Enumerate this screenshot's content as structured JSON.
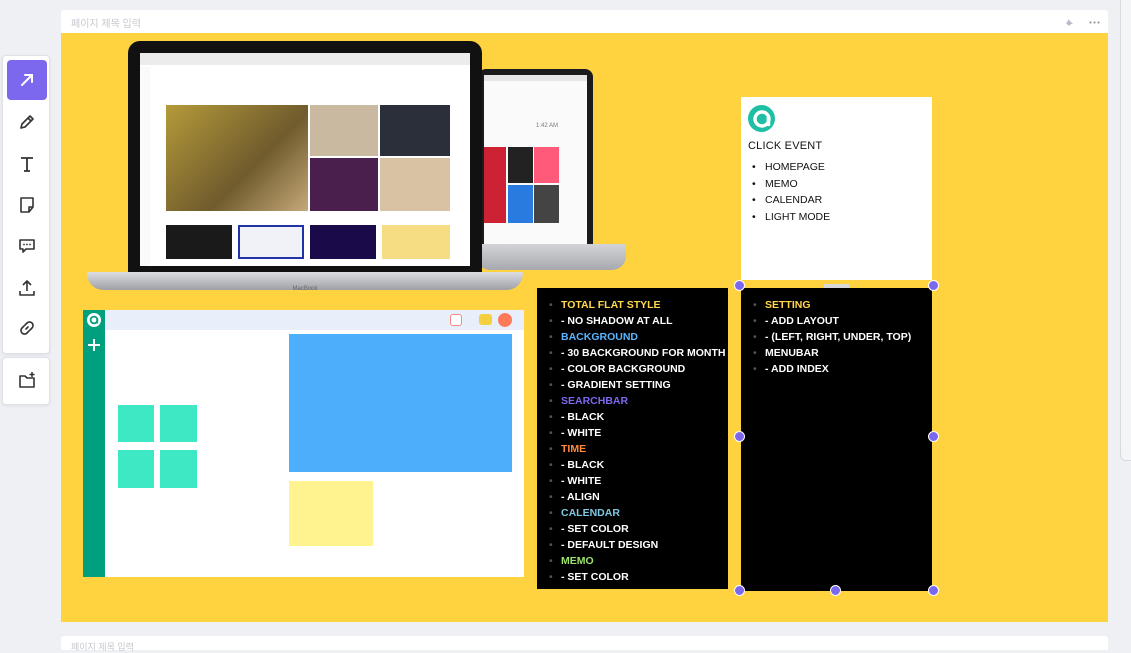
{
  "frame": {
    "title": "페이지 제목 입력",
    "next_title": "페이지 제목 입력"
  },
  "toolbar": {
    "tools": [
      {
        "name": "select-tool",
        "icon": "arrow-cursor-icon",
        "active": true
      },
      {
        "name": "pen-tool",
        "icon": "pencil-icon"
      },
      {
        "name": "text-tool",
        "icon": "text-t-icon"
      },
      {
        "name": "sticky-note-tool",
        "icon": "sticky-note-icon"
      },
      {
        "name": "comment-tool",
        "icon": "comment-icon"
      },
      {
        "name": "upload-tool",
        "icon": "upload-icon"
      },
      {
        "name": "link-tool",
        "icon": "link-icon"
      }
    ],
    "extra": {
      "name": "add-folder-tool",
      "icon": "folder-plus-icon"
    }
  },
  "laptop": {
    "brand": "MacBook",
    "time": "1:42 AM"
  },
  "click_card": {
    "title": "CLICK EVENT",
    "items": [
      "HOMEPAGE",
      "MEMO",
      "CALENDAR",
      "LIGHT MODE"
    ]
  },
  "features_list": {
    "items": [
      {
        "text": "TOTAL FLAT STYLE",
        "color": "#ffd84d"
      },
      {
        "text": "- NO SHADOW AT ALL",
        "color": "#ffffff"
      },
      {
        "text": "BACKGROUND",
        "color": "#5ab4ff"
      },
      {
        "text": "- 30 BACKGROUND FOR MONTH",
        "color": "#ffffff"
      },
      {
        "text": "- COLOR BACKGROUND",
        "color": "#ffffff"
      },
      {
        "text": "- GRADIENT SETTING",
        "color": "#ffffff"
      },
      {
        "text": "SEARCHBAR",
        "color": "#7b68ee"
      },
      {
        "text": "- BLACK",
        "color": "#ffffff"
      },
      {
        "text": "- WHITE",
        "color": "#ffffff"
      },
      {
        "text": "TIME",
        "color": "#ff8a3d"
      },
      {
        "text": "- BLACK",
        "color": "#ffffff"
      },
      {
        "text": "- WHITE",
        "color": "#ffffff"
      },
      {
        "text": "- ALIGN",
        "color": "#ffffff"
      },
      {
        "text": "CALENDAR",
        "color": "#7ec8e3"
      },
      {
        "text": "- SET COLOR",
        "color": "#ffffff"
      },
      {
        "text": "- DEFAULT DESIGN",
        "color": "#ffffff"
      },
      {
        "text": "MEMO",
        "color": "#9be36b"
      },
      {
        "text": "- SET COLOR",
        "color": "#ffffff"
      }
    ]
  },
  "setting_list": {
    "items": [
      {
        "text": "SETTING",
        "color": "#ffd84d"
      },
      {
        "text": "- ADD LAYOUT",
        "color": "#ffffff"
      },
      {
        "text": "- (LEFT, RIGHT, UNDER, TOP)",
        "color": "#ffffff"
      },
      {
        "text": "MENUBAR",
        "color": "#ffffff"
      },
      {
        "text": "- ADD INDEX",
        "color": "#ffffff"
      }
    ]
  },
  "colors": {
    "canvas": "#ffd23f",
    "accent": "#7b68ee",
    "brand_teal": "#00a07e",
    "tile_mint": "#3ee8c4",
    "block_blue": "#4daefc",
    "block_yellow": "#fff38f"
  }
}
